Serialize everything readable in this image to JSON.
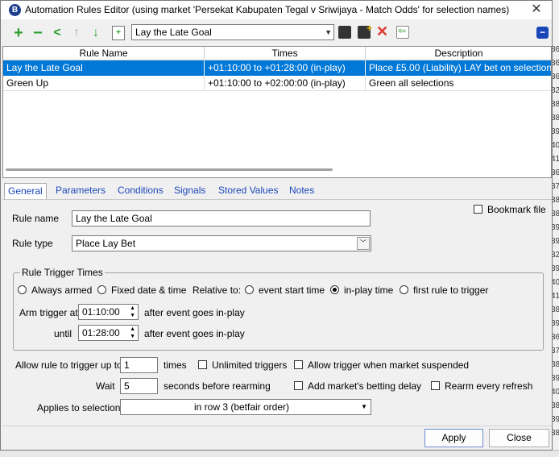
{
  "window": {
    "title": "Automation Rules Editor (using market 'Persekat Kabupaten Tegal v Sriwijaya - Match Odds' for selection names)",
    "app_icon": "B",
    "close_glyph": "✕"
  },
  "toolbar": {
    "selected_rule": "Lay the Late Goal",
    "icons": [
      "add-icon",
      "remove-icon",
      "share-icon",
      "move-up-icon",
      "move-down-icon",
      "new-file-icon",
      "save-icon",
      "save-new-icon",
      "delete-icon",
      "import-icon",
      "collapse-icon"
    ]
  },
  "grid": {
    "columns": [
      "Rule Name",
      "Times",
      "Description"
    ],
    "rows": [
      {
        "name": "Lay the Late Goal",
        "times": "+01:10:00 to +01:28:00 (in-play)",
        "description": "Place £5.00 (Liability) LAY bet on selection in"
      },
      {
        "name": "Green Up",
        "times": "+01:10:00 to +02:00:00 (in-play)",
        "description": "Green all selections"
      }
    ]
  },
  "tabs": [
    "General",
    "Parameters",
    "Conditions",
    "Signals",
    "Stored Values",
    "Notes"
  ],
  "general": {
    "rule_name_label": "Rule name",
    "rule_name_value": "Lay the Late Goal",
    "bookmark_label": "Bookmark file",
    "rule_type_label": "Rule type",
    "rule_type_value": "Place Lay Bet",
    "trigger_group_title": "Rule Trigger Times",
    "always_armed": "Always armed",
    "fixed_date": "Fixed date & time",
    "relative_to": "Relative to:",
    "event_start": "event start time",
    "inplay_time": "in-play time",
    "first_rule": "first rule to trigger",
    "arm_label": "Arm trigger at",
    "arm_value": "01:10:00",
    "arm_suffix": "after event goes in-play",
    "until_label": "until",
    "until_value": "01:28:00",
    "until_suffix": "after event goes in-play",
    "allow_label": "Allow rule to trigger up to",
    "allow_value": "1",
    "times_label": "times",
    "unlimited_label": "Unlimited triggers",
    "suspended_label": "Allow trigger when market suspended",
    "wait_label": "Wait",
    "wait_value": "5",
    "seconds_label": "seconds before rearming",
    "betting_delay_label": "Add market's betting delay",
    "rearm_label": "Rearm every refresh",
    "applies_label": "Applies to selection",
    "applies_value": "in row 3 (betfair order)"
  },
  "buttons": {
    "apply": "Apply",
    "close": "Close"
  },
  "background_numbers": [
    "36",
    "36",
    "36",
    "32",
    "38",
    "38",
    "39",
    "40",
    "41",
    "36",
    "37",
    "38",
    "38",
    "39",
    "39",
    "32",
    "39",
    "40",
    "41",
    "38",
    "39",
    "36",
    "37",
    "38",
    "39",
    "40",
    "38",
    "39",
    "38"
  ],
  "colors": {
    "selection": "#0078d7",
    "tab_text": "#1a47b8",
    "add_green": "#2e9e2e",
    "delete_red": "#e03a2f"
  }
}
